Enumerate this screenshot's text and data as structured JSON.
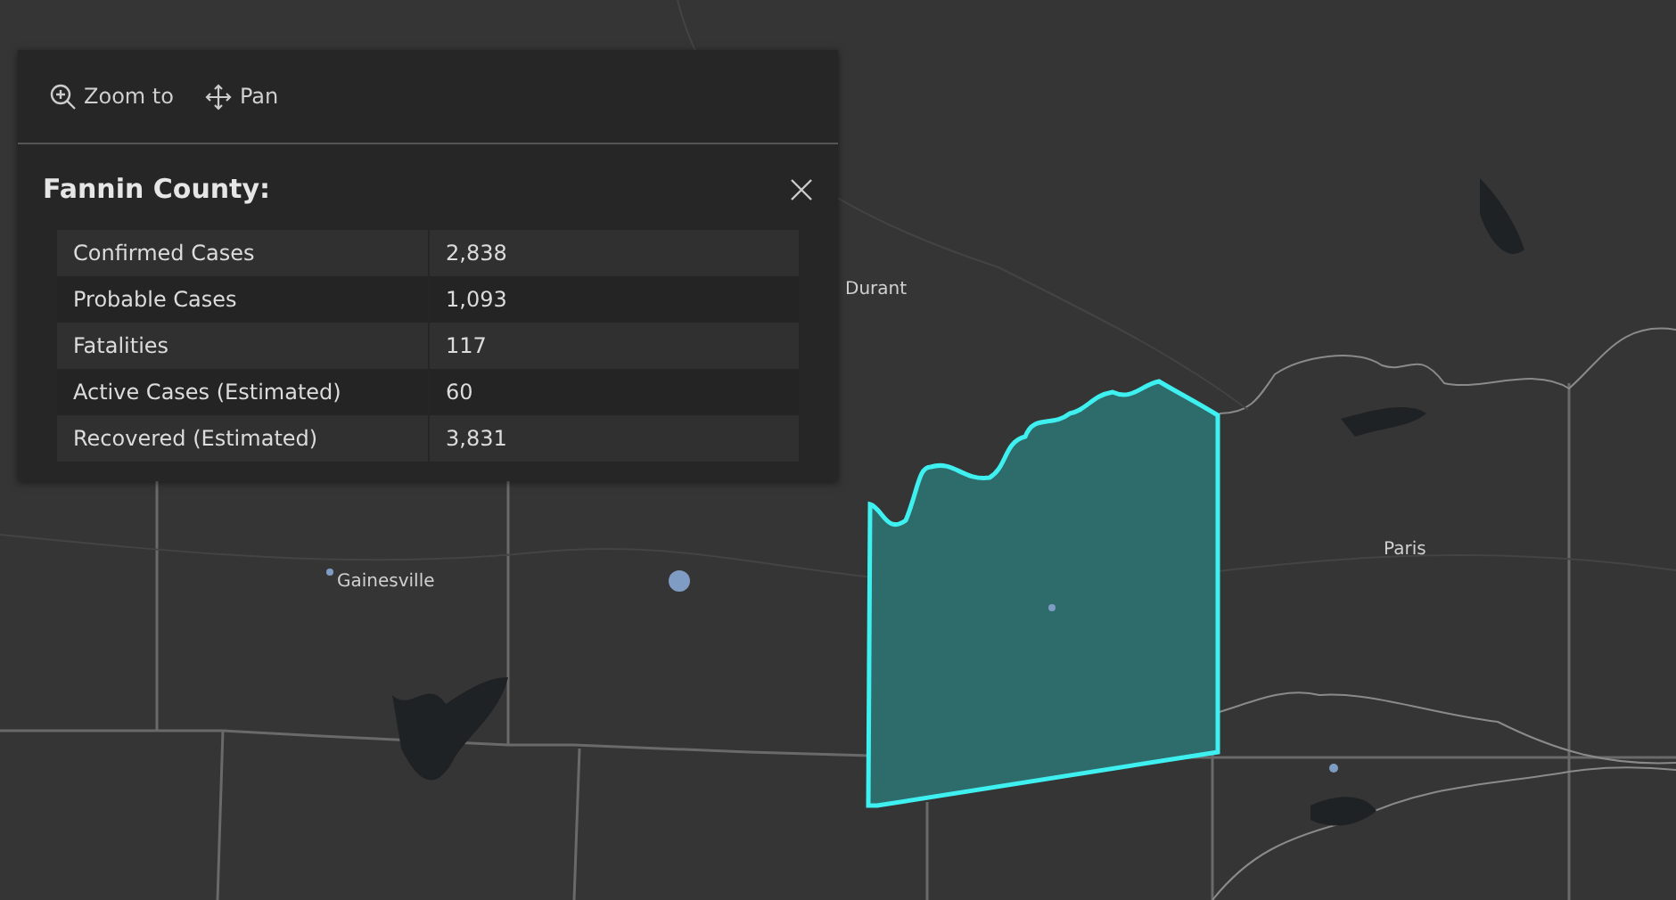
{
  "popup": {
    "actions": [
      {
        "kind": "zoom",
        "label": "Zoom to"
      },
      {
        "kind": "pan",
        "label": "Pan"
      }
    ],
    "title": "Fannin County:",
    "rows": [
      {
        "label": "Confirmed Cases",
        "value": "2,838"
      },
      {
        "label": "Probable Cases",
        "value": "1,093"
      },
      {
        "label": "Fatalities",
        "value": "117"
      },
      {
        "label": "Active Cases (Estimated)",
        "value": "60"
      },
      {
        "label": "Recovered (Estimated)",
        "value": "3,831"
      }
    ]
  },
  "map": {
    "places": [
      "Durant",
      "Gainesville",
      "Paris"
    ]
  }
}
